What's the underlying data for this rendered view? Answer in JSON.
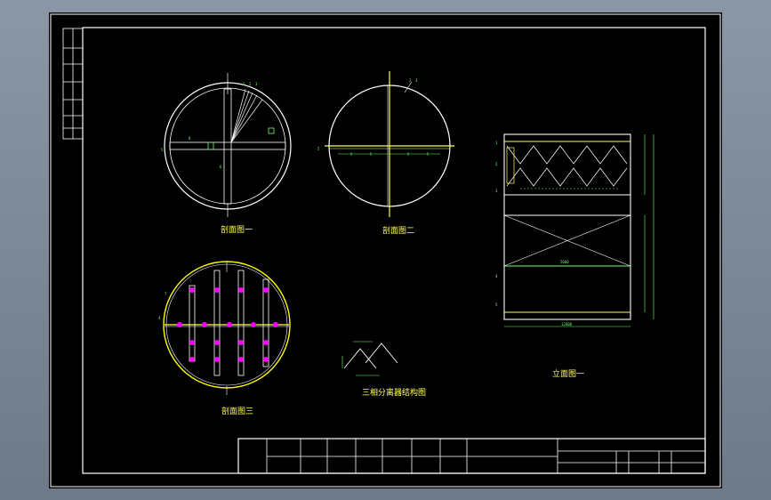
{
  "drawing": {
    "section_labels": {
      "section_1": "剖面图一",
      "section_2": "剖面图二",
      "section_3": "剖面图三",
      "elevation_1": "立面图一",
      "separator_structure": "三相分离器结构图"
    },
    "callouts": {
      "c1": "1",
      "c2": "2",
      "c3": "3",
      "c4": "4",
      "c5": "5",
      "c6": "6",
      "c7": "7",
      "c8": "8"
    },
    "dimension_text": {
      "d_width": "5600",
      "d_main": "12600",
      "d_small": "500"
    }
  },
  "colors": {
    "background": "#000000",
    "frame": "#ffffff",
    "label": "#ffff55",
    "annotation": "#70ff70",
    "outer_circle": "#ffff00",
    "nozzle": "#ff00ff"
  }
}
